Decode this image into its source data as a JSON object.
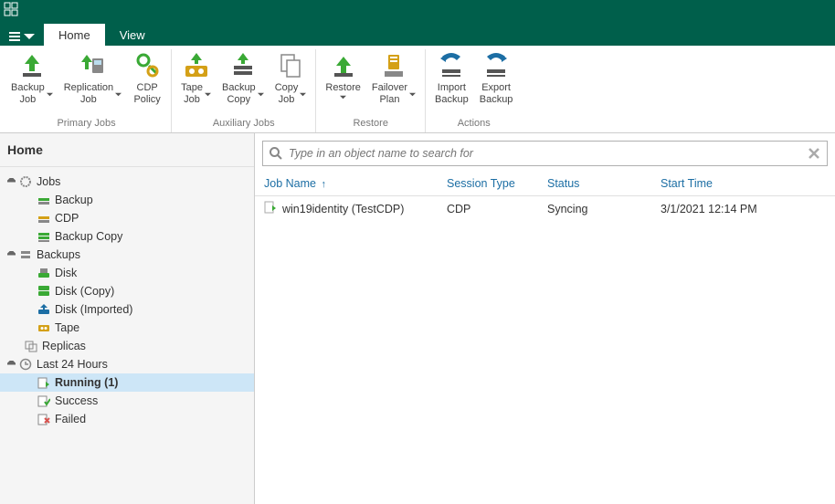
{
  "tabs": {
    "file_caret": "▾",
    "home": "Home",
    "view": "View"
  },
  "ribbon": {
    "primary": {
      "label": "Primary Jobs",
      "backup": "Backup\nJob",
      "replication": "Replication\nJob",
      "cdp": "CDP\nPolicy"
    },
    "aux": {
      "label": "Auxiliary Jobs",
      "tape": "Tape\nJob",
      "backup_copy": "Backup\nCopy",
      "copy_job": "Copy\nJob"
    },
    "restore": {
      "label": "Restore",
      "restore": "Restore",
      "failover": "Failover\nPlan"
    },
    "actions": {
      "label": "Actions",
      "import": "Import\nBackup",
      "export": "Export\nBackup"
    }
  },
  "sidebar": {
    "header": "Home",
    "jobs": {
      "label": "Jobs",
      "backup": "Backup",
      "cdp": "CDP",
      "backup_copy": "Backup Copy"
    },
    "backups": {
      "label": "Backups",
      "disk": "Disk",
      "disk_copy": "Disk (Copy)",
      "disk_imported": "Disk (Imported)",
      "tape": "Tape"
    },
    "replicas": "Replicas",
    "last24": {
      "label": "Last 24 Hours",
      "running": "Running (1)",
      "success": "Success",
      "failed": "Failed"
    }
  },
  "search": {
    "placeholder": "Type in an object name to search for"
  },
  "grid": {
    "cols": {
      "job_name": "Job Name",
      "session_type": "Session Type",
      "status": "Status",
      "start_time": "Start Time"
    },
    "rows": [
      {
        "name": "win19identity (TestCDP)",
        "type": "CDP",
        "status": "Syncing",
        "start": "3/1/2021 12:14 PM"
      }
    ]
  }
}
